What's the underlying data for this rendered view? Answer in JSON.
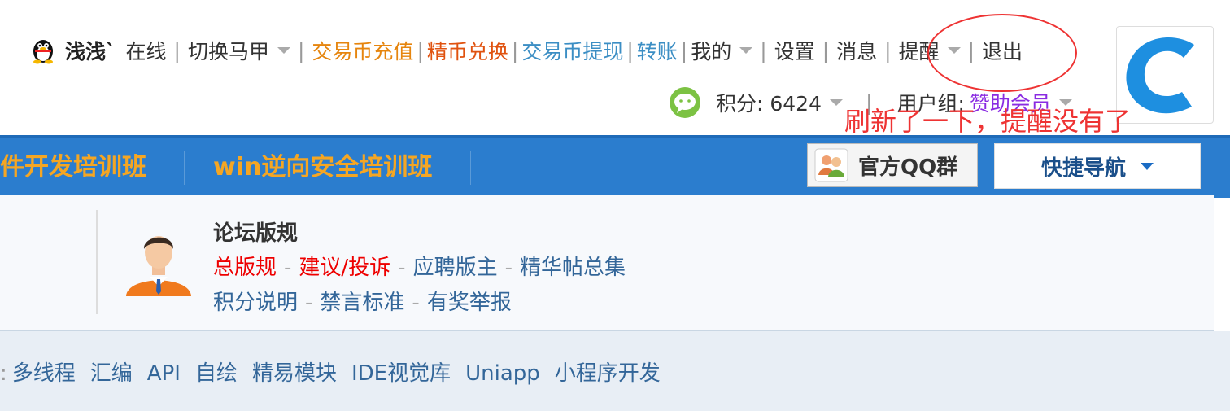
{
  "userbar": {
    "username": "浅浅`",
    "status": "在线",
    "switch_alt": "切换马甲",
    "recharge": "交易币充值",
    "exchange": "精币兑换",
    "withdraw": "交易币提现",
    "transfer": "转账",
    "mine": "我的",
    "settings": "设置",
    "messages": "消息",
    "reminders": "提醒",
    "logout": "退出"
  },
  "userinfo": {
    "points_label": "积分: 6424",
    "group_label": "用户组:",
    "group_value": "赞助会员"
  },
  "annotation": {
    "text": "刷新了一下，提醒没有了",
    "color": "#e33333"
  },
  "nav": {
    "item1": "件开发培训班",
    "item2": "win逆向安全培训班",
    "qq_group": "官方QQ群",
    "quick_nav": "快捷导航"
  },
  "rules": {
    "title": "论坛版规",
    "row1": [
      "总版规",
      "建议/投诉",
      "应聘版主",
      "精华帖总集"
    ],
    "row2": [
      "积分说明",
      "禁言标准",
      "有奖举报"
    ]
  },
  "bottom_links": [
    "多线程",
    "汇编",
    "API",
    "自绘",
    "精易模块",
    "IDE视觉库",
    "Uniapp",
    "小程序开发"
  ],
  "colors": {
    "nav_bg": "#2b7dce",
    "nav_text": "#f5a623",
    "link_blue": "#336699",
    "link_red": "#e00000"
  }
}
